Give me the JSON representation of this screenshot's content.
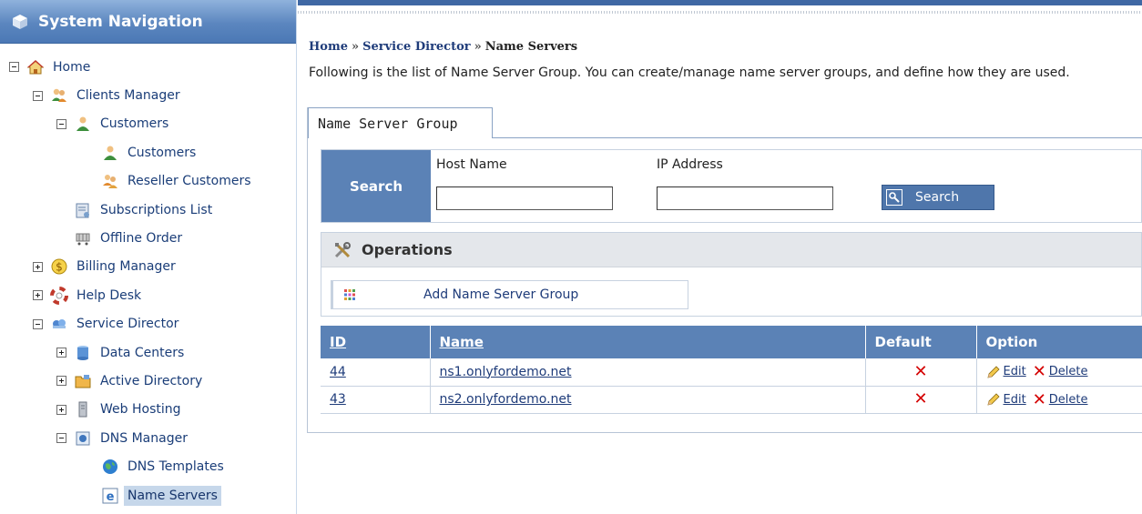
{
  "sidebar": {
    "title": "System Navigation",
    "items": [
      {
        "label": "Home",
        "icon": "home-icon",
        "toggle": "minus",
        "level": 0
      },
      {
        "label": "Clients Manager",
        "icon": "clients-icon",
        "toggle": "minus",
        "level": 1
      },
      {
        "label": "Customers",
        "icon": "customer-icon",
        "toggle": "minus",
        "level": 2
      },
      {
        "label": "Customers",
        "icon": "customer-icon",
        "toggle": "none",
        "level": 3
      },
      {
        "label": "Reseller Customers",
        "icon": "reseller-icon",
        "toggle": "none",
        "level": 3
      },
      {
        "label": "Subscriptions List",
        "icon": "subscription-icon",
        "toggle": "none",
        "level": 2
      },
      {
        "label": "Offline Order",
        "icon": "cart-icon",
        "toggle": "none",
        "level": 2
      },
      {
        "label": "Billing Manager",
        "icon": "billing-icon",
        "toggle": "plus",
        "level": 1
      },
      {
        "label": "Help Desk",
        "icon": "helpdesk-icon",
        "toggle": "plus",
        "level": 1
      },
      {
        "label": "Service Director",
        "icon": "service-director-icon",
        "toggle": "minus",
        "level": 1
      },
      {
        "label": "Data Centers",
        "icon": "datacenter-icon",
        "toggle": "plus",
        "level": 2
      },
      {
        "label": "Active Directory",
        "icon": "folder-icon",
        "toggle": "plus",
        "level": 2
      },
      {
        "label": "Web Hosting",
        "icon": "server-icon",
        "toggle": "plus",
        "level": 2
      },
      {
        "label": "DNS Manager",
        "icon": "dns-icon",
        "toggle": "minus",
        "level": 2
      },
      {
        "label": "DNS Templates",
        "icon": "globe-icon",
        "toggle": "none",
        "level": 3
      },
      {
        "label": "Name Servers",
        "icon": "ie-icon",
        "toggle": "none",
        "level": 3,
        "selected": true
      }
    ]
  },
  "breadcrumb": {
    "home": "Home",
    "sep": "»",
    "service_director": "Service Director",
    "current": "Name Servers"
  },
  "description": "Following is the list of Name Server Group. You can create/manage name server groups, and define how they are used.",
  "tab": {
    "label": "Name Server Group"
  },
  "search": {
    "label": "Search",
    "host_label": "Host Name",
    "host_value": "",
    "ip_label": "IP Address",
    "ip_value": "",
    "button_label": "Search"
  },
  "operations": {
    "title": "Operations",
    "add_label": "Add Name Server Group"
  },
  "table": {
    "headers": {
      "id": "ID",
      "name": "Name",
      "default": "Default",
      "option": "Option"
    },
    "rows": [
      {
        "id": "44",
        "name": "ns1.onlyfordemo.net",
        "edit": "Edit",
        "delete": "Delete"
      },
      {
        "id": "43",
        "name": "ns2.onlyfordemo.net",
        "edit": "Edit",
        "delete": "Delete"
      }
    ]
  },
  "colors": {
    "accent": "#5b82b6",
    "header_gradient_top": "#8fb2dc",
    "link": "#1f3c7a",
    "delete_red": "#d40000"
  }
}
